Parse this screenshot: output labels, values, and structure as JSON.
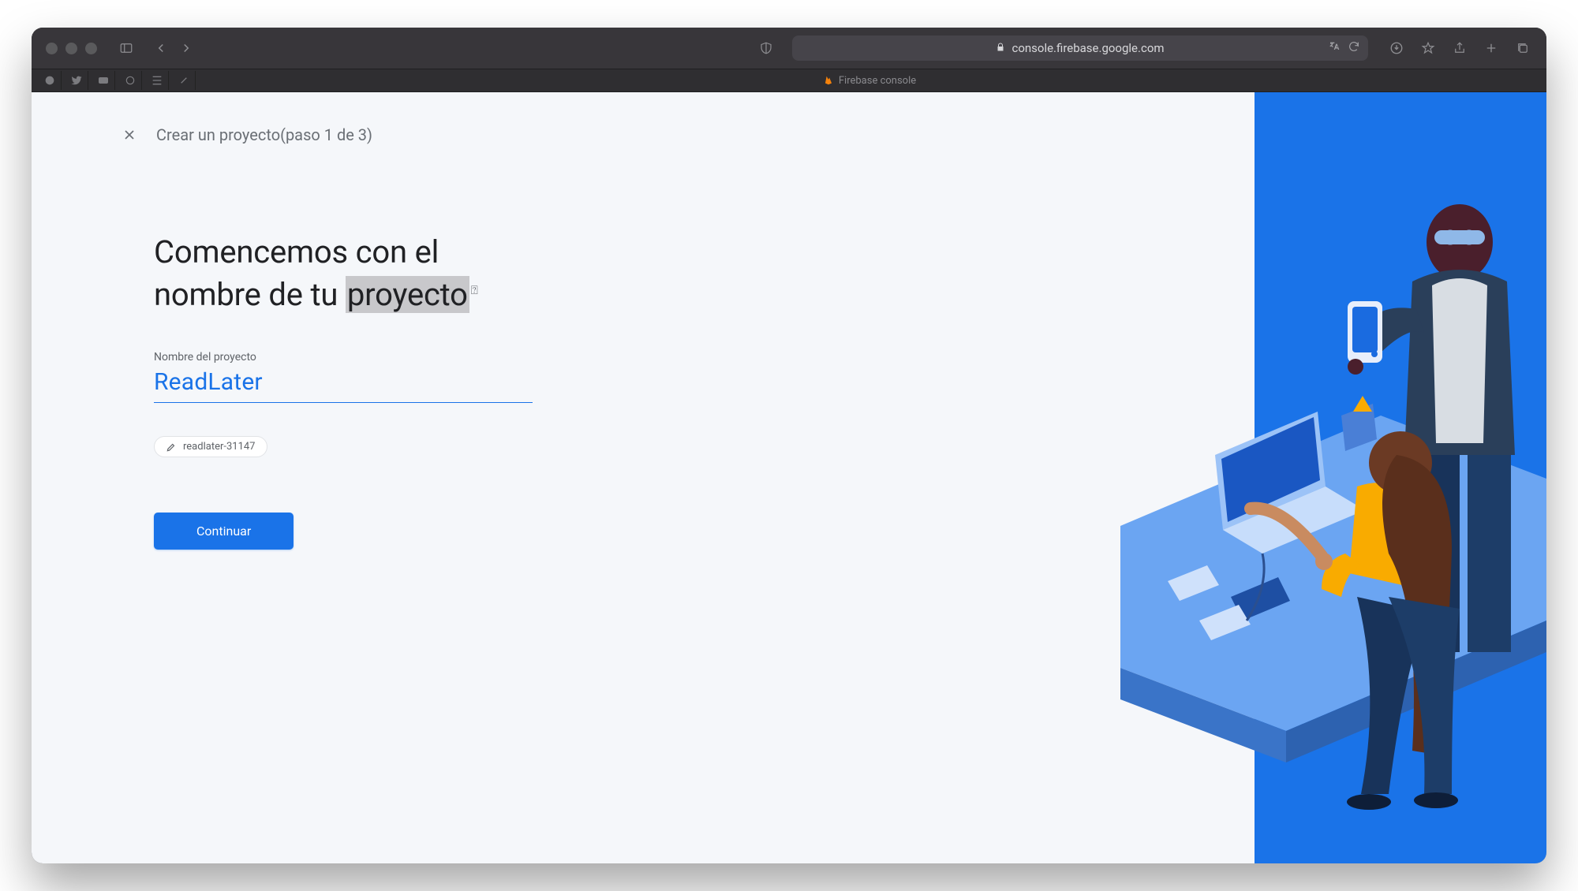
{
  "browser": {
    "url": "console.firebase.google.com",
    "tab_title": "Firebase console"
  },
  "header": {
    "title_prefix": "Crear un proyecto",
    "title_step": "(paso 1 de 3)"
  },
  "form": {
    "headline_part1": "Comencemos con el",
    "headline_part2_prefix": "nombre de tu ",
    "headline_highlight": "proyecto",
    "help_symbol": "⍰",
    "field_label": "Nombre del proyecto",
    "field_value": "ReadLater",
    "project_id_chip": "readlater-31147",
    "continue_label": "Continuar"
  },
  "colors": {
    "accent": "#1a73e8",
    "text_primary": "#202124",
    "text_secondary": "#5f6368",
    "page_bg": "#f5f7fa"
  }
}
